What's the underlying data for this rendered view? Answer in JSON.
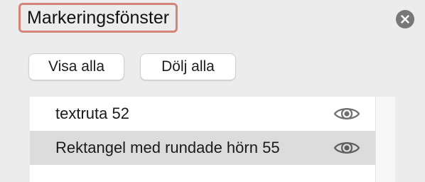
{
  "panel": {
    "title": "Markeringsfönster",
    "close_icon": "close-circle-icon"
  },
  "toolbar": {
    "show_all_label": "Visa alla",
    "hide_all_label": "Dölj alla"
  },
  "objects": [
    {
      "label": "textruta 52",
      "visibility_icon": "eye-icon",
      "visible": true,
      "selected": false
    },
    {
      "label": "Rektangel med rundade hörn 55",
      "visibility_icon": "eye-icon",
      "visible": true,
      "selected": true
    }
  ],
  "colors": {
    "background": "#ececec",
    "title_highlight": "#d38479",
    "selected_row": "#dcdcdc",
    "close_button": "#787878"
  }
}
